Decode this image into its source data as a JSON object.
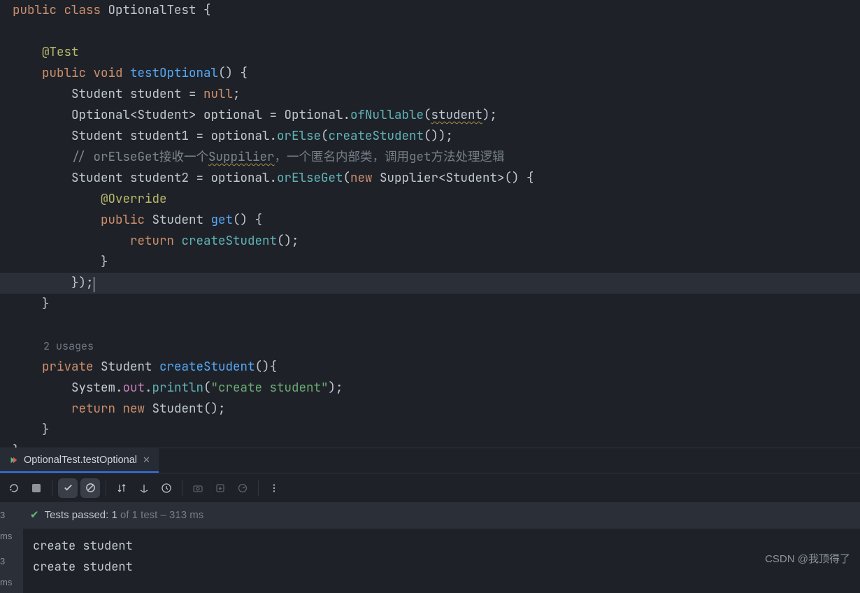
{
  "code": {
    "classDecl": {
      "public": "public",
      "class_kw": "class",
      "className": "OptionalTest",
      "brace": " {"
    },
    "testAnn": "@Test",
    "sig": {
      "public": "public",
      "void": "void",
      "name": "testOptional",
      "parens": "() {"
    },
    "l1": {
      "type": "Student",
      "var": "student",
      "eq": " = ",
      "null_kw": "null",
      "semi": ";"
    },
    "l2": {
      "optType": "Optional",
      "lt": "<",
      "genType": "Student",
      "gt": ">",
      "var": "optional",
      "eq": " = ",
      "cls": "Optional",
      "dot": ".",
      "method": "ofNullable",
      "lp": "(",
      "arg": "student",
      "rp": ");"
    },
    "l3": {
      "type": "Student",
      "var": "student1",
      "eq": " = optional.",
      "method": "orElse",
      "lp": "(",
      "call": "createStudent",
      "tail": "());"
    },
    "l4": {
      "text": "// orElseGet接收一个",
      "warn": "Suppilier",
      "tail": "，一个匿名内部类，调用get方法处理逻辑"
    },
    "l5": {
      "type": "Student",
      "var": "student2",
      "eq": " = optional.",
      "method": "orElseGet",
      "lp": "(",
      "new_kw": "new",
      "sp": " Supplier<Student>() {"
    },
    "l6": {
      "ann": "@Override"
    },
    "l7": {
      "public": "public",
      "ret": "Student",
      "name": "get",
      "tail": "() {"
    },
    "l8": {
      "ret": "return",
      "call": "createStudent",
      "tail": "();"
    },
    "l9": {
      "brace": "}"
    },
    "l10": {
      "close": "});"
    },
    "l11": {
      "brace": "}"
    },
    "usageLabel": "2 usages",
    "m2": {
      "priv": "private",
      "ret": "Student",
      "name": "createStudent",
      "tail": "(){"
    },
    "m3": {
      "sys": "System",
      "dot1": ".",
      "out": "out",
      "dot2": ".",
      "println": "println",
      "lp": "(",
      "str": "\"create student\"",
      "rp": ");"
    },
    "m4": {
      "ret": "return",
      "new_kw": "new",
      "cls": "Student",
      "tail": "();"
    },
    "m5": {
      "brace": "}"
    },
    "closeClass": "}"
  },
  "panel": {
    "tabLabel": "OptionalTest.testOptional",
    "status": {
      "prefix": "Tests passed: ",
      "passed": "1",
      "of": " of 1 test",
      "time": " – 313 ms"
    },
    "leftTimes": [
      "3 ms",
      "3 ms"
    ],
    "console": [
      "create student",
      "create student"
    ]
  },
  "watermark": "CSDN @我顶得了"
}
